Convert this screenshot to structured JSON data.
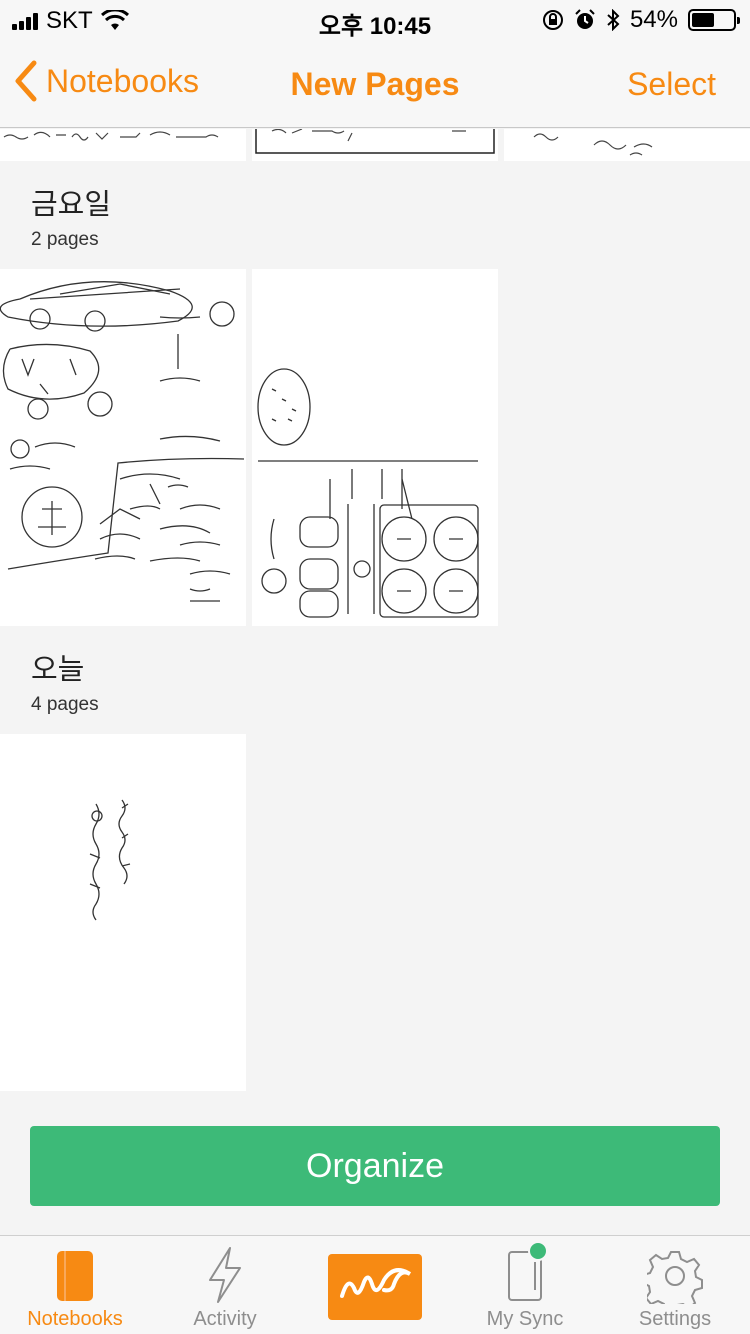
{
  "status_bar": {
    "carrier": "SKT",
    "time": "오후 10:45",
    "battery_percent": "54%",
    "battery_level": 0.54
  },
  "nav": {
    "back_label": "Notebooks",
    "title": "New Pages",
    "select_label": "Select"
  },
  "sections": [
    {
      "title": "금요일",
      "count": "2 pages"
    },
    {
      "title": "오늘",
      "count": "4 pages"
    }
  ],
  "organize_label": "Organize",
  "tabs": [
    {
      "label": "Notebooks",
      "icon": "notebook-icon",
      "active": true
    },
    {
      "label": "Activity",
      "icon": "lightning-icon",
      "active": false
    },
    {
      "label": "",
      "icon": "handwriting-icon",
      "active": false
    },
    {
      "label": "My Sync",
      "icon": "sync-device-icon",
      "active": false
    },
    {
      "label": "Settings",
      "icon": "gear-icon",
      "active": false
    }
  ],
  "colors": {
    "accent": "#f78a13",
    "organize": "#3dba78"
  }
}
